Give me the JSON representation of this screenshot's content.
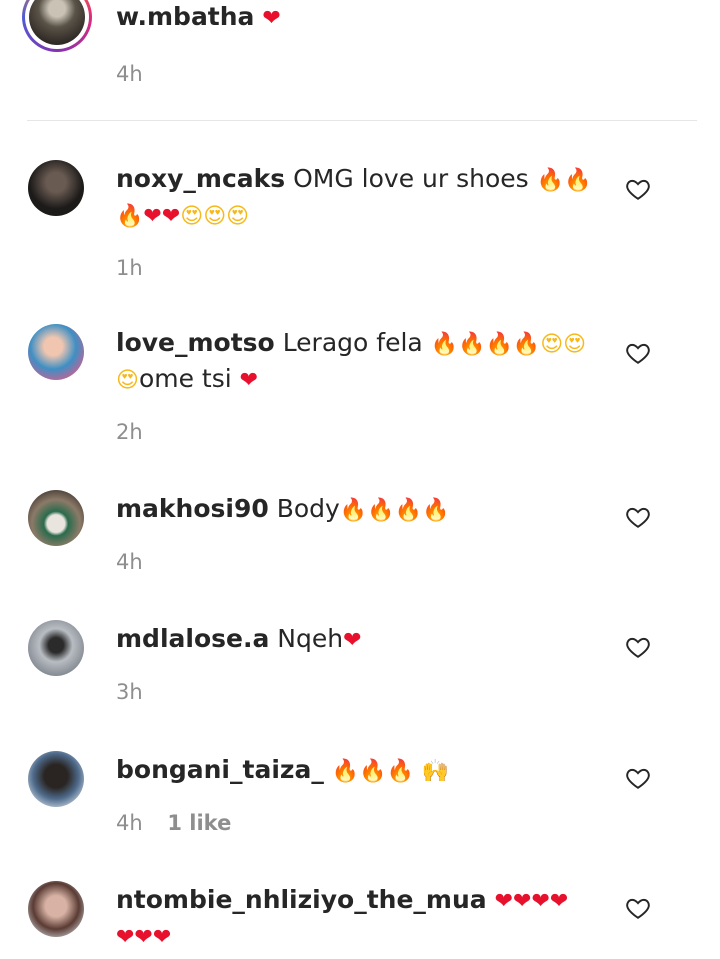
{
  "caption": {
    "username": "w.mbatha",
    "text_emojis": "❤",
    "time": "4h"
  },
  "comments": [
    {
      "username": "noxy_mcaks",
      "text": "OMG love ur shoes 🔥🔥🔥❤❤😍😍😍",
      "time": "1h",
      "likes": "",
      "avatar_color": "#1c1c1c"
    },
    {
      "username": "love_motso",
      "text": "Lerago fela 🔥🔥🔥🔥😍😍😍ome tsi ❤",
      "time": "2h",
      "likes": "",
      "avatar_color": "#3b8fbf"
    },
    {
      "username": "makhosi90",
      "text": "Body🔥🔥🔥🔥",
      "time": "4h",
      "likes": "",
      "avatar_color": "#6b5a4a"
    },
    {
      "username": "mdlalose.a",
      "text": "Nqeh❤",
      "time": "3h",
      "likes": "",
      "avatar_color": "#8a8f96"
    },
    {
      "username": "bongani_taiza_",
      "text": "🔥🔥🔥 🙌",
      "time": "4h",
      "likes": "1 like",
      "avatar_color": "#3a4d6b"
    },
    {
      "username": "ntombie_nhliziyo_the_mua",
      "text": "❤❤❤❤❤❤❤",
      "time": "",
      "likes": "",
      "avatar_color": "#b9978a"
    }
  ],
  "icons": {
    "like": "heart-outline-icon"
  }
}
